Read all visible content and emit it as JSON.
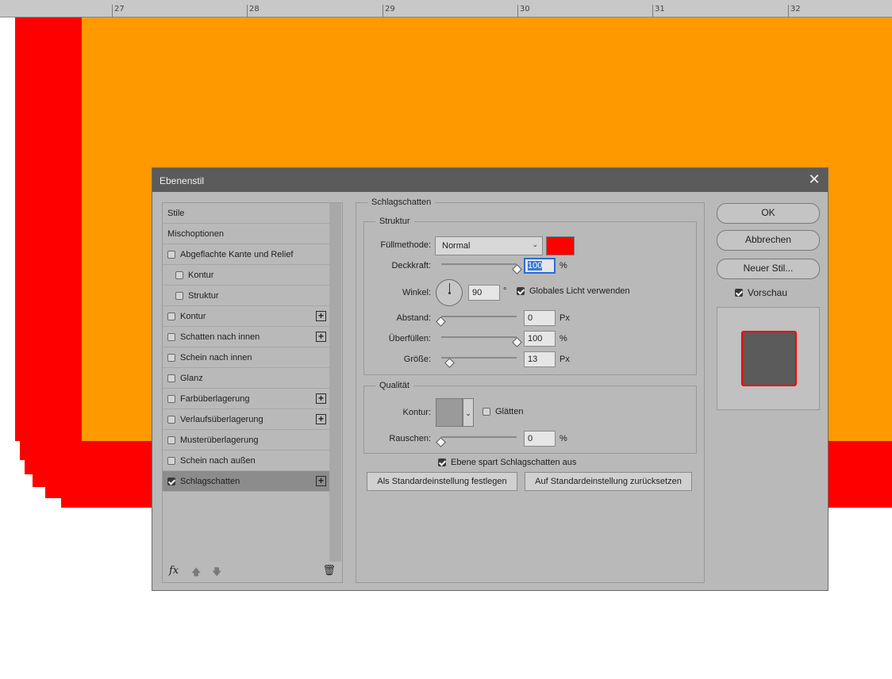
{
  "ruler": {
    "labels": [
      "27",
      "28",
      "29",
      "30",
      "31",
      "32"
    ]
  },
  "dialog": {
    "title": "Ebenenstil",
    "close_glyph": "✕",
    "styles": [
      {
        "label": "Stile",
        "type": "header"
      },
      {
        "label": "Mischoptionen",
        "type": "header"
      },
      {
        "label": "Abgeflachte Kante und Relief",
        "checked": false
      },
      {
        "label": "Kontur",
        "checked": false,
        "indent": true
      },
      {
        "label": "Struktur",
        "checked": false,
        "indent": true
      },
      {
        "label": "Kontur",
        "checked": false,
        "plus": true
      },
      {
        "label": "Schatten nach innen",
        "checked": false,
        "plus": true
      },
      {
        "label": "Schein nach innen",
        "checked": false
      },
      {
        "label": "Glanz",
        "checked": false
      },
      {
        "label": "Farbüberlagerung",
        "checked": false,
        "plus": true
      },
      {
        "label": "Verlaufsüberlagerung",
        "checked": false,
        "plus": true
      },
      {
        "label": "Musterüberlagerung",
        "checked": false
      },
      {
        "label": "Schein nach außen",
        "checked": false
      },
      {
        "label": "Schlagschatten",
        "checked": true,
        "plus": true,
        "selected": true
      }
    ],
    "footer": {
      "fx": "fx",
      "up": "🡅",
      "down": "🡇",
      "trash": "🗑"
    },
    "section_title": "Schlagschatten",
    "structure": {
      "legend": "Struktur",
      "blend_label": "Füllmethode:",
      "blend_value": "Normal",
      "blend_color": "#ff0000",
      "opacity_label": "Deckkraft:",
      "opacity_value": "100",
      "opacity_unit": "%",
      "angle_label": "Winkel:",
      "angle_value": "90",
      "angle_unit": "°",
      "global_light_label": "Globales Licht verwenden",
      "global_light_checked": true,
      "distance_label": "Abstand:",
      "distance_value": "0",
      "distance_unit": "Px",
      "spread_label": "Überfüllen:",
      "spread_value": "100",
      "spread_unit": "%",
      "size_label": "Größe:",
      "size_value": "13",
      "size_unit": "Px"
    },
    "quality": {
      "legend": "Qualität",
      "contour_label": "Kontur:",
      "smooth_label": "Glätten",
      "noise_label": "Rauschen:",
      "noise_value": "0",
      "noise_unit": "%"
    },
    "knockout_label": "Ebene spart Schlagschatten aus",
    "make_default": "Als Standardeinstellung festlegen",
    "reset_default": "Auf Standardeinstellung zurücksetzen",
    "ok": "OK",
    "cancel": "Abbrechen",
    "new_style": "Neuer Stil...",
    "preview_label": "Vorschau"
  },
  "colors": {
    "orange": "#ff9900",
    "red": "#ff0000",
    "dialog_bg": "#b9b9b9",
    "titlebar": "#5b5b5b"
  }
}
